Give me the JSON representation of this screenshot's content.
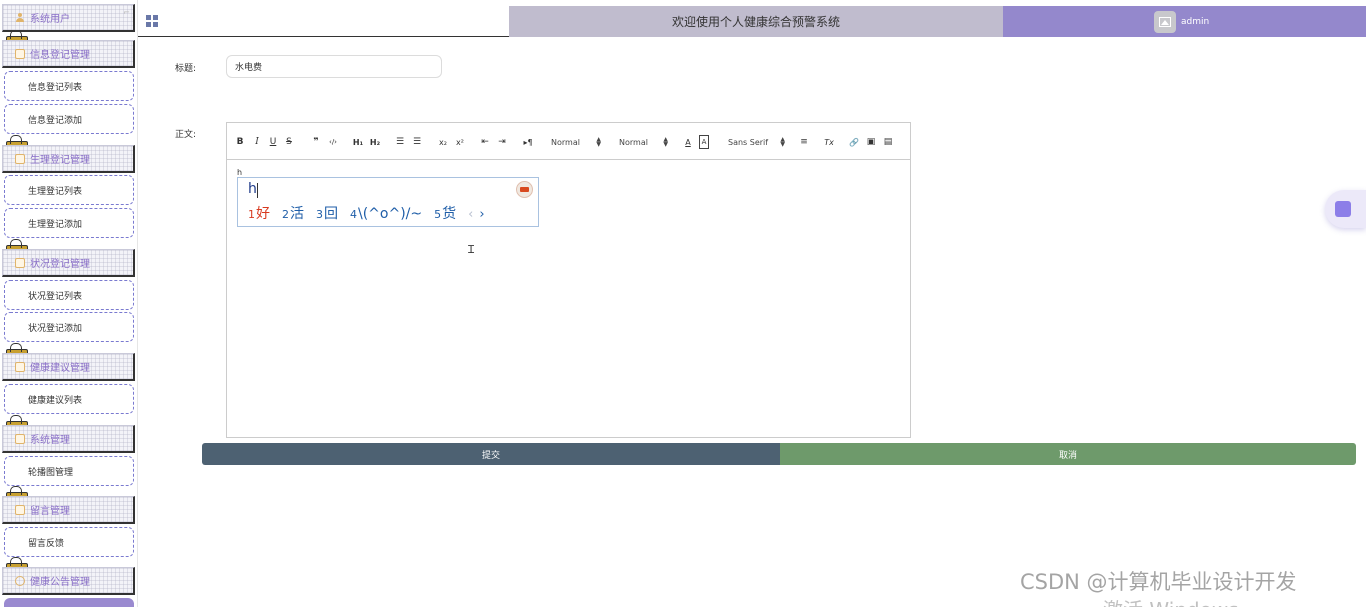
{
  "header": {
    "title": "欢迎使用个人健康综合预警系统",
    "username": "admin"
  },
  "sidebar": {
    "sections": [
      {
        "label": "系统用户",
        "items": []
      },
      {
        "label": "信息登记管理",
        "items": [
          "信息登记列表",
          "信息登记添加"
        ]
      },
      {
        "label": "生理登记管理",
        "items": [
          "生理登记列表",
          "生理登记添加"
        ]
      },
      {
        "label": "状况登记管理",
        "items": [
          "状况登记列表",
          "状况登记添加"
        ]
      },
      {
        "label": "健康建议管理",
        "items": [
          "健康建议列表"
        ]
      },
      {
        "label": "系统管理",
        "items": [
          "轮播图管理"
        ]
      },
      {
        "label": "留言管理",
        "items": [
          "留言反馈"
        ]
      },
      {
        "label": "健康公告管理",
        "items": []
      }
    ]
  },
  "form": {
    "title_label": "标题:",
    "title_value": "水电费",
    "content_label": "正文:",
    "editor_text": "h",
    "submit_label": "提交",
    "cancel_label": "取消"
  },
  "toolbar": {
    "bold": "B",
    "italic": "I",
    "underline": "U",
    "strike": "S",
    "blockquote": "❞",
    "code": "‹/›",
    "h1": "H₁",
    "h2": "H₂",
    "ordered_list": "☰",
    "bullet_list": "☰",
    "subscript": "x₂",
    "superscript": "x²",
    "outdent": "⇤",
    "indent": "⇥",
    "direction": "▸¶",
    "size_select": "Normal",
    "header_select": "Normal",
    "color": "A",
    "background": "A",
    "font_select": "Sans Serif",
    "align": "≡",
    "clean": "Tx",
    "link": "🔗",
    "image": "▣",
    "video": "▤"
  },
  "ime": {
    "input": "h",
    "candidates": [
      {
        "num": "1",
        "text": "好"
      },
      {
        "num": "2",
        "text": "活"
      },
      {
        "num": "3",
        "text": "回"
      },
      {
        "num": "4",
        "text": "\\(^o^)/~"
      },
      {
        "num": "5",
        "text": "货"
      }
    ],
    "prev": "‹",
    "next": "›"
  },
  "watermark": "CSDN @计算机毕业设计开发",
  "windows_activation": "激活 Windows"
}
